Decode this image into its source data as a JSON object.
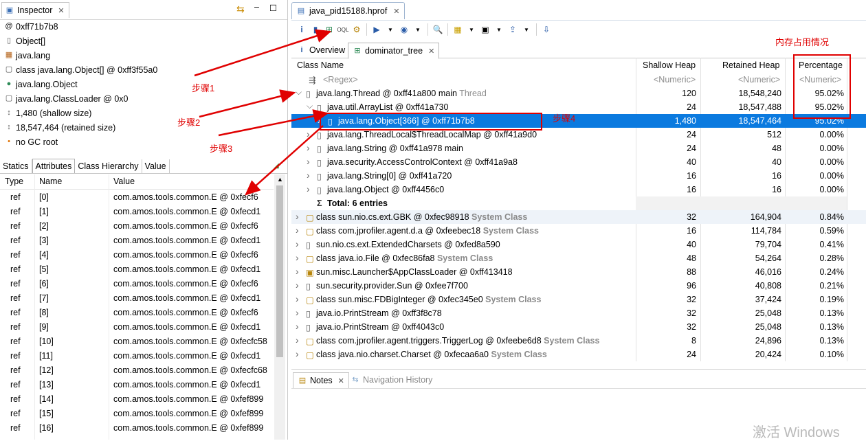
{
  "inspector": {
    "title": "Inspector",
    "info": [
      {
        "icon": "at-icon",
        "text": "0xff71b7b8"
      },
      {
        "icon": "array-icon",
        "text": "Object[]"
      },
      {
        "icon": "package-icon",
        "text": "java.lang"
      },
      {
        "icon": "class-icon",
        "text": "class java.lang.Object[] @ 0xff3f55a0"
      },
      {
        "icon": "object-icon",
        "text": "java.lang.Object"
      },
      {
        "icon": "class-icon",
        "text": "java.lang.ClassLoader @ 0x0"
      },
      {
        "icon": "size-icon",
        "text": "1,480 (shallow size)"
      },
      {
        "icon": "size-icon",
        "text": "18,547,464 (retained size)"
      },
      {
        "icon": "gc-root-icon",
        "text": "no GC root"
      }
    ],
    "tabs": [
      "Statics",
      "Attributes",
      "Class Hierarchy",
      "Value"
    ],
    "columns": [
      "Type",
      "Name",
      "Value"
    ],
    "rows": [
      {
        "type": "ref",
        "name": "[0]",
        "value": "com.amos.tools.common.E @ 0xfecf6"
      },
      {
        "type": "ref",
        "name": "[1]",
        "value": "com.amos.tools.common.E @ 0xfecd1"
      },
      {
        "type": "ref",
        "name": "[2]",
        "value": "com.amos.tools.common.E @ 0xfecf6"
      },
      {
        "type": "ref",
        "name": "[3]",
        "value": "com.amos.tools.common.E @ 0xfecd1"
      },
      {
        "type": "ref",
        "name": "[4]",
        "value": "com.amos.tools.common.E @ 0xfecf6"
      },
      {
        "type": "ref",
        "name": "[5]",
        "value": "com.amos.tools.common.E @ 0xfecd1"
      },
      {
        "type": "ref",
        "name": "[6]",
        "value": "com.amos.tools.common.E @ 0xfecf6"
      },
      {
        "type": "ref",
        "name": "[7]",
        "value": "com.amos.tools.common.E @ 0xfecd1"
      },
      {
        "type": "ref",
        "name": "[8]",
        "value": "com.amos.tools.common.E @ 0xfecf6"
      },
      {
        "type": "ref",
        "name": "[9]",
        "value": "com.amos.tools.common.E @ 0xfecd1"
      },
      {
        "type": "ref",
        "name": "[10]",
        "value": "com.amos.tools.common.E @ 0xfecfc58"
      },
      {
        "type": "ref",
        "name": "[11]",
        "value": "com.amos.tools.common.E @ 0xfecd1"
      },
      {
        "type": "ref",
        "name": "[12]",
        "value": "com.amos.tools.common.E @ 0xfecfc68"
      },
      {
        "type": "ref",
        "name": "[13]",
        "value": "com.amos.tools.common.E @ 0xfecd1"
      },
      {
        "type": "ref",
        "name": "[14]",
        "value": "com.amos.tools.common.E @ 0xfef899"
      },
      {
        "type": "ref",
        "name": "[15]",
        "value": "com.amos.tools.common.E @ 0xfef899"
      },
      {
        "type": "ref",
        "name": "[16]",
        "value": "com.amos.tools.common.E @ 0xfef899"
      }
    ]
  },
  "editor": {
    "file_tab": "java_pid15188.hprof",
    "tabs": [
      "Overview",
      "dominator_tree"
    ],
    "columns": [
      "Class Name",
      "Shallow Heap",
      "Retained Heap",
      "Percentage"
    ],
    "filters": [
      "<Regex>",
      "<Numeric>",
      "<Numeric>",
      "<Numeric>"
    ],
    "rows": [
      {
        "text": "java.lang.Thread @ 0xff41a800  main ",
        "suffix": "Thread",
        "shallow": "120",
        "retained": "18,548,240",
        "pct": "95.02%"
      },
      {
        "text": "java.util.ArrayList @ 0xff41a730",
        "suffix": "",
        "shallow": "24",
        "retained": "18,547,488",
        "pct": "95.02%"
      },
      {
        "text": "java.lang.Object[366] @ 0xff71b7b8",
        "suffix": "",
        "shallow": "1,480",
        "retained": "18,547,464",
        "pct": "95.02%"
      },
      {
        "text": "java.lang.ThreadLocal$ThreadLocalMap @ 0xff41a9d0",
        "suffix": "",
        "shallow": "24",
        "retained": "512",
        "pct": "0.00%"
      },
      {
        "text": "java.lang.String @ 0xff41a978  main",
        "suffix": "",
        "shallow": "24",
        "retained": "48",
        "pct": "0.00%"
      },
      {
        "text": "java.security.AccessControlContext @ 0xff41a9a8",
        "suffix": "",
        "shallow": "40",
        "retained": "40",
        "pct": "0.00%"
      },
      {
        "text": "java.lang.String[0] @ 0xff41a720",
        "suffix": "",
        "shallow": "16",
        "retained": "16",
        "pct": "0.00%"
      },
      {
        "text": "java.lang.Object @ 0xff4456c0",
        "suffix": "",
        "shallow": "16",
        "retained": "16",
        "pct": "0.00%"
      },
      {
        "text": "Total: 6 entries",
        "suffix": "",
        "shallow": "",
        "retained": "",
        "pct": ""
      },
      {
        "text": "class sun.nio.cs.ext.GBK @ 0xfec98918 ",
        "suffix": "System Class",
        "shallow": "32",
        "retained": "164,904",
        "pct": "0.84%"
      },
      {
        "text": "class com.jprofiler.agent.d.a @ 0xfeebec18 ",
        "suffix": "System Class",
        "shallow": "16",
        "retained": "114,784",
        "pct": "0.59%"
      },
      {
        "text": "sun.nio.cs.ext.ExtendedCharsets @ 0xfed8a590",
        "suffix": "",
        "shallow": "40",
        "retained": "79,704",
        "pct": "0.41%"
      },
      {
        "text": "class java.io.File @ 0xfec86fa8 ",
        "suffix": "System Class",
        "shallow": "48",
        "retained": "54,264",
        "pct": "0.28%"
      },
      {
        "text": "sun.misc.Launcher$AppClassLoader @ 0xff413418",
        "suffix": "",
        "shallow": "88",
        "retained": "46,016",
        "pct": "0.24%"
      },
      {
        "text": "sun.security.provider.Sun @ 0xfee7f700",
        "suffix": "",
        "shallow": "96",
        "retained": "40,808",
        "pct": "0.21%"
      },
      {
        "text": "class sun.misc.FDBigInteger @ 0xfec345e0 ",
        "suffix": "System Class",
        "shallow": "32",
        "retained": "37,424",
        "pct": "0.19%"
      },
      {
        "text": "java.io.PrintStream @ 0xff3f8c78",
        "suffix": "",
        "shallow": "32",
        "retained": "25,048",
        "pct": "0.13%"
      },
      {
        "text": "java.io.PrintStream @ 0xff4043c0",
        "suffix": "",
        "shallow": "32",
        "retained": "25,048",
        "pct": "0.13%"
      },
      {
        "text": "class com.jprofiler.agent.triggers.TriggerLog @ 0xfeebe6d8 ",
        "suffix": "System Class",
        "shallow": "8",
        "retained": "24,896",
        "pct": "0.13%"
      },
      {
        "text": "class java.nio.charset.Charset @ 0xfecaa6a0 ",
        "suffix": "System Class",
        "shallow": "24",
        "retained": "20,424",
        "pct": "0.10%"
      }
    ]
  },
  "bottom": {
    "notes_tab": "Notes",
    "history_tab": "Navigation History"
  },
  "annotations": {
    "step1": "步骤1",
    "step2": "步骤2",
    "step3": "步骤3",
    "step4": "步骤4",
    "memory": "内存占用情况"
  },
  "watermark": "激活 Windows",
  "colors": {
    "selection": "#0b7adf",
    "annotation": "#e00000"
  }
}
